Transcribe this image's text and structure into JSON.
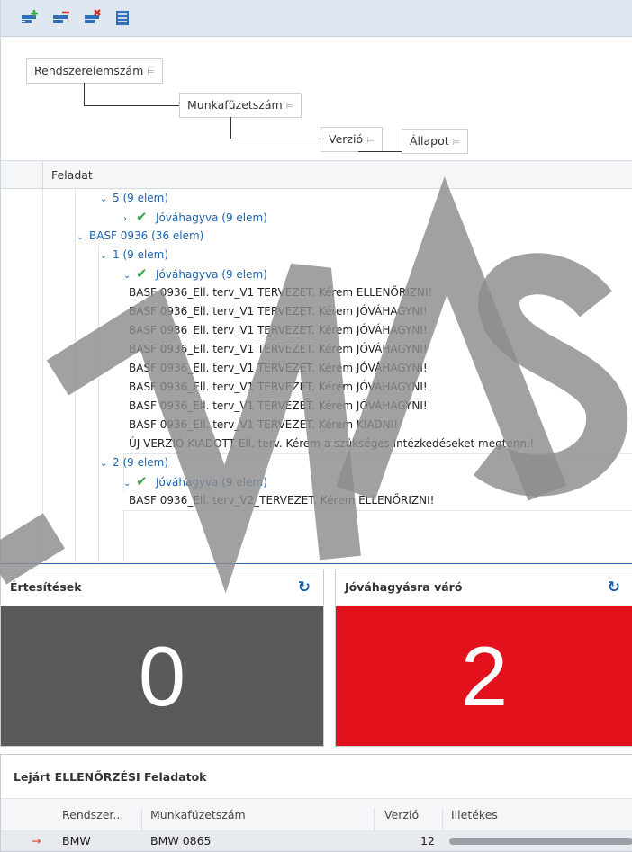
{
  "toolbar": {
    "buttons": [
      {
        "icon": "add-row-icon"
      },
      {
        "icon": "remove-row-icon"
      },
      {
        "icon": "delete-row-icon"
      },
      {
        "icon": "list-icon"
      }
    ],
    "colors": {
      "bg": "#dfe7f0",
      "icon_blue": "#2f6fb5",
      "icon_green": "#3aa64a",
      "icon_red": "#d0312d"
    }
  },
  "grouping": {
    "chips": [
      "Rendszerelemszám",
      "Munkafüzetszám",
      "Verzió",
      "Állapot"
    ],
    "sort_icon": "sort-icon"
  },
  "grid": {
    "column_header": "Feladat",
    "rows": [
      {
        "kind": "group",
        "text": "5 (9 elem)",
        "expanded": true
      },
      {
        "kind": "status",
        "text": "Jóváhagyva (9 elem)",
        "expanded": false
      },
      {
        "kind": "group",
        "text": "BASF 0936 (36 elem)",
        "expanded": true
      },
      {
        "kind": "group",
        "text": "1 (9 elem)",
        "expanded": true
      },
      {
        "kind": "status",
        "text": "Jóváhagyva (9 elem)",
        "expanded": true
      },
      {
        "kind": "data",
        "text": "BASF 0936_Ell. terv_V1 TERVEZET. Kérem ELLENŐRIZNI!"
      },
      {
        "kind": "data",
        "text": "BASF 0936_Ell. terv_V1 TERVEZET. Kérem JÓVÁHAGYNI!"
      },
      {
        "kind": "data",
        "text": "BASF 0936_Ell. terv_V1 TERVEZET. Kérem JÓVÁHAGYNI!"
      },
      {
        "kind": "data",
        "text": "BASF 0936_Ell. terv_V1 TERVEZET. Kérem JÓVÁHAGYNI!"
      },
      {
        "kind": "data",
        "text": "BASF 0936_Ell. terv_V1 TERVEZET. Kérem JÓVÁHAGYNI!"
      },
      {
        "kind": "data",
        "text": "BASF 0936_Ell. terv_V1 TERVEZET. Kérem JÓVÁHAGYNI!"
      },
      {
        "kind": "data",
        "text": "BASF 0936_Ell. terv_V1 TERVEZET. Kérem JÓVÁHAGYNI!"
      },
      {
        "kind": "data",
        "text": "BASF 0936_Ell. terv_V1 TERVEZET. Kérem KIADNI!"
      },
      {
        "kind": "data",
        "text": "ÚJ VERZIÓ KIADOTT Ell. terv. Kérem a szükséges intézkedéseket megtenni!"
      },
      {
        "kind": "group",
        "text": "2 (9 elem)",
        "expanded": true
      },
      {
        "kind": "status",
        "text": "Jóváhagyva (9 elem)",
        "expanded": true
      },
      {
        "kind": "data",
        "text": "BASF 0936_Ell. terv_V2_TERVEZET. Kérem ELLENŐRIZNI!"
      }
    ]
  },
  "tiles": [
    {
      "title": "Értesítések",
      "value": "0",
      "bg": "#5a5a5a",
      "refresh_icon": "refresh-icon"
    },
    {
      "title": "Jóváhagyásra váró",
      "value": "2",
      "bg": "#e2111c",
      "refresh_icon": "refresh-icon"
    }
  ],
  "overdue": {
    "title": "Lejárt ELLENŐRZÉSI Feladatok",
    "columns": [
      "Rendszer...",
      "Munkafüzetszám",
      "Verzió",
      "Illetékes"
    ],
    "rows": [
      {
        "system": "BMW",
        "workbook": "BMW 0865",
        "version": "12"
      }
    ],
    "row_icon": "arrow-right-icon"
  },
  "watermark": {
    "text": "MAS",
    "color": "#8c8c8c"
  }
}
